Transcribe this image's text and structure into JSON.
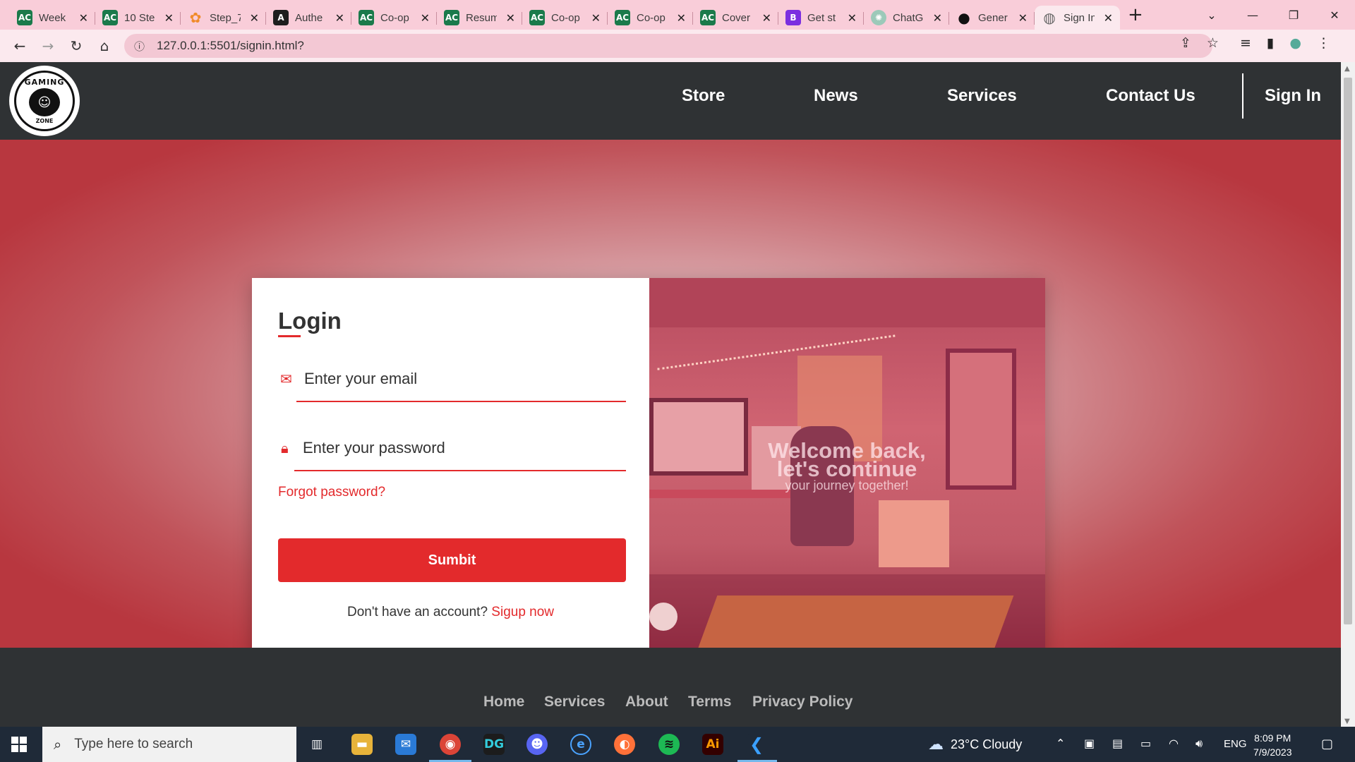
{
  "browser": {
    "tabs": [
      {
        "label": "Week",
        "favicon": "ac-icon",
        "active": false
      },
      {
        "label": "10 Ste",
        "favicon": "ac-icon",
        "active": false
      },
      {
        "label": "Step_7",
        "favicon": "step-icon",
        "active": false
      },
      {
        "label": "Authe",
        "favicon": "auth-icon",
        "active": false
      },
      {
        "label": "Co-op",
        "favicon": "ac-icon",
        "active": false
      },
      {
        "label": "Resum",
        "favicon": "ac-icon",
        "active": false
      },
      {
        "label": "Co-op",
        "favicon": "ac-icon",
        "active": false
      },
      {
        "label": "Co-op",
        "favicon": "ac-icon",
        "active": false
      },
      {
        "label": "Cover",
        "favicon": "ac-icon",
        "active": false
      },
      {
        "label": "Get st",
        "favicon": "bootstrap-icon",
        "active": false
      },
      {
        "label": "ChatG",
        "favicon": "chatgpt-icon",
        "active": false
      },
      {
        "label": "Gener",
        "favicon": "github-icon",
        "active": false
      },
      {
        "label": "Sign In",
        "favicon": "globe-icon",
        "active": true
      }
    ],
    "url": "127.0.0.1:5501/signin.html?"
  },
  "site": {
    "nav": {
      "store": "Store",
      "news": "News",
      "services": "Services",
      "contact": "Contact Us",
      "signin": "Sign In"
    },
    "logo": {
      "top": "GAMING",
      "bottom": "ZONE"
    },
    "login": {
      "title": "Login",
      "email_placeholder": "Enter your email",
      "password_placeholder": "Enter your password",
      "forgot": "Forgot password?",
      "submit": "Sumbit",
      "signup_prompt": "Don't have an account?",
      "signup_link": "Sigup now"
    },
    "welcome": {
      "line1": "Welcome back,",
      "line2": "let's continue",
      "line3": "your journey together!"
    },
    "footer": {
      "home": "Home",
      "services": "Services",
      "about": "About",
      "terms": "Terms",
      "privacy": "Privacy Policy"
    },
    "colors": {
      "accent": "#e32a2c",
      "header": "#2f3234"
    }
  },
  "taskbar": {
    "search_placeholder": "Type here to search",
    "weather": "23°C  Cloudy",
    "language": "ENG",
    "time": "8:09 PM",
    "date": "7/9/2023"
  }
}
